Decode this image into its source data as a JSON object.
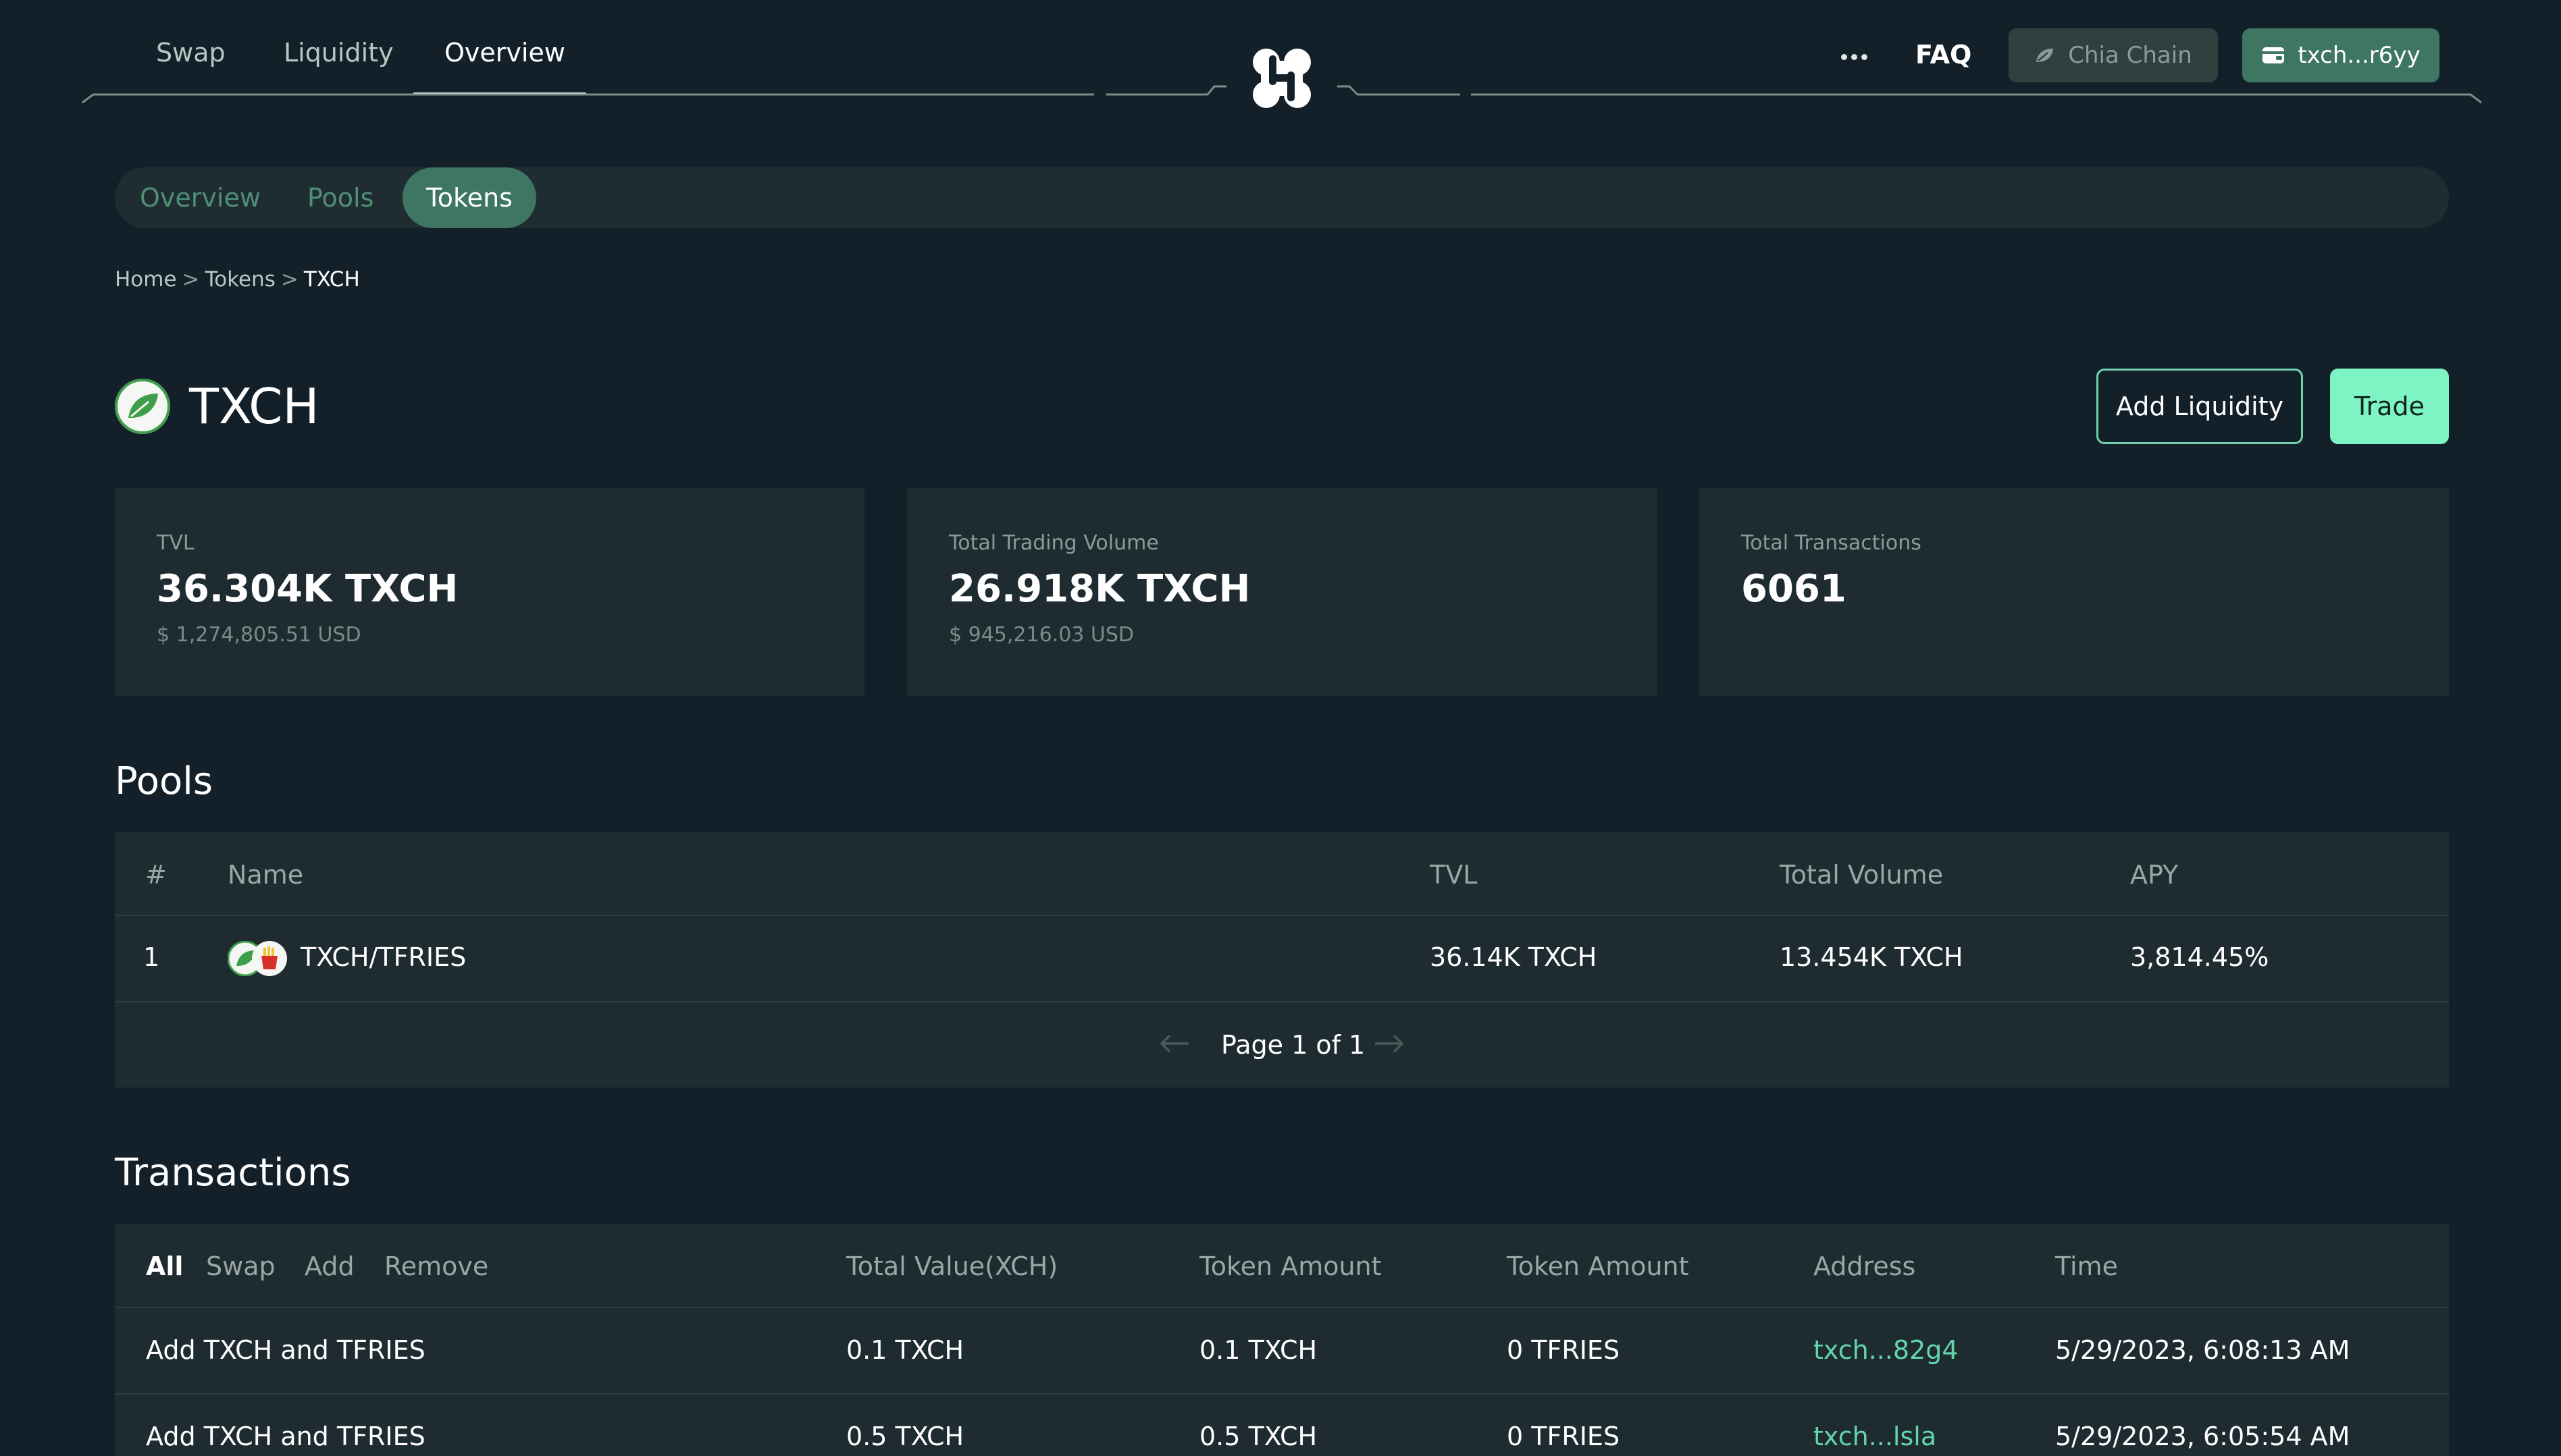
{
  "nav": {
    "links": [
      {
        "label": "Swap",
        "active": false
      },
      {
        "label": "Liquidity",
        "active": false
      },
      {
        "label": "Overview",
        "active": true
      }
    ],
    "faq_label": "FAQ",
    "chain_label": "Chia Chain",
    "wallet_label": "txch...r6yy",
    "more_icon": "more-dots-icon",
    "logo_icon": "tibetswap-logo"
  },
  "subtabs": [
    {
      "label": "Overview",
      "active": false
    },
    {
      "label": "Pools",
      "active": false
    },
    {
      "label": "Tokens",
      "active": true
    }
  ],
  "breadcrumb": {
    "items": [
      "Home",
      "Tokens",
      "TXCH"
    ],
    "separator": ">"
  },
  "token": {
    "symbol": "TXCH",
    "icon": "leaf-icon",
    "add_liquidity_label": "Add Liquidity",
    "trade_label": "Trade"
  },
  "stats": [
    {
      "label": "TVL",
      "value": "36.304K TXCH",
      "sub": "$ 1,274,805.51 USD"
    },
    {
      "label": "Total Trading Volume",
      "value": "26.918K TXCH",
      "sub": "$ 945,216.03 USD"
    },
    {
      "label": "Total Transactions",
      "value": "6061",
      "sub": ""
    }
  ],
  "pools": {
    "title": "Pools",
    "columns": [
      "#",
      "Name",
      "TVL",
      "Total Volume",
      "APY"
    ],
    "rows": [
      {
        "index": "1",
        "name": "TXCH/TFRIES",
        "tvl": "36.14K TXCH",
        "volume": "13.454K TXCH",
        "apy": "3,814.45%"
      }
    ],
    "pager_text": "Page 1 of 1"
  },
  "transactions": {
    "title": "Transactions",
    "filters": [
      {
        "label": "All",
        "active": true
      },
      {
        "label": "Swap",
        "active": false
      },
      {
        "label": "Add",
        "active": false
      },
      {
        "label": "Remove",
        "active": false
      }
    ],
    "columns": [
      "Total Value(XCH)",
      "Token Amount",
      "Token Amount",
      "Address",
      "Time"
    ],
    "rows": [
      {
        "action": "Add TXCH and TFRIES",
        "total_value": "0.1 TXCH",
        "token_amount_1": "0.1 TXCH",
        "token_amount_2": "0 TFRIES",
        "address": "txch...82g4",
        "time": "5/29/2023, 6:08:13 AM"
      },
      {
        "action": "Add TXCH and TFRIES",
        "total_value": "0.5 TXCH",
        "token_amount_1": "0.5 TXCH",
        "token_amount_2": "0 TFRIES",
        "address": "txch...lsla",
        "time": "5/29/2023, 6:05:54 AM"
      }
    ]
  },
  "colors": {
    "background": "#13202a",
    "panel": "#1e2b31",
    "accent": "#7ef4c4",
    "accent_dark": "#3e7663",
    "link": "#62d6a9"
  }
}
